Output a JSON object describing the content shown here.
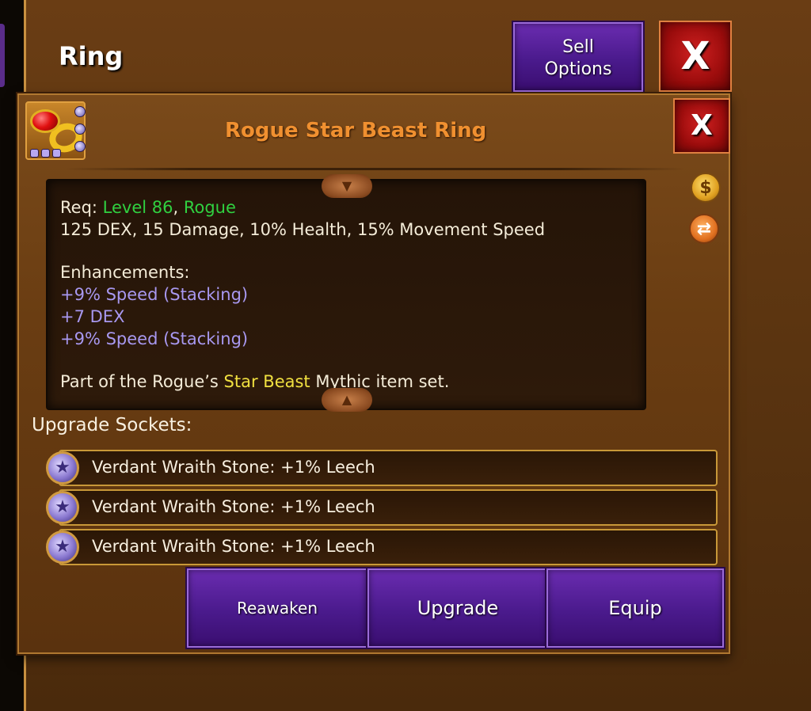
{
  "background": {
    "title": "Ring",
    "sell_button": {
      "line1": "Sell",
      "line2": "Options"
    },
    "close_label": "X"
  },
  "dialog": {
    "title": "Rogue Star Beast Ring",
    "close_label": "X",
    "item_icon": "ruby-ring-icon",
    "side_icons": [
      "gold-bag-icon",
      "swap-icon"
    ],
    "description": {
      "req_label": "Req: ",
      "req_level": "Level 86",
      "req_sep": ", ",
      "req_class": "Rogue",
      "stats": "125 DEX, 15 Damage, 10% Health, 15% Movement Speed",
      "enh_heading": "Enhancements:",
      "enhancements": [
        "+9% Speed (Stacking)",
        "+7 DEX",
        "+9% Speed (Stacking)"
      ],
      "set_prefix": "Part of the Rogue’s ",
      "set_name": "Star Beast",
      "set_suffix": " Mythic item set."
    },
    "sockets_heading": "Upgrade Sockets:",
    "sockets": [
      "Verdant Wraith Stone: +1% Leech",
      "Verdant Wraith Stone: +1% Leech",
      "Verdant Wraith Stone: +1% Leech"
    ],
    "buttons": {
      "reawaken": "Reawaken",
      "upgrade": "Upgrade",
      "equip": "Equip"
    }
  },
  "colors": {
    "title": "#f09030",
    "requirement": "#30d040",
    "enhancement": "#a898f0",
    "set_name": "#f0e040",
    "button_purple": "#4a1a8c",
    "close_red": "#9a0c0c"
  }
}
